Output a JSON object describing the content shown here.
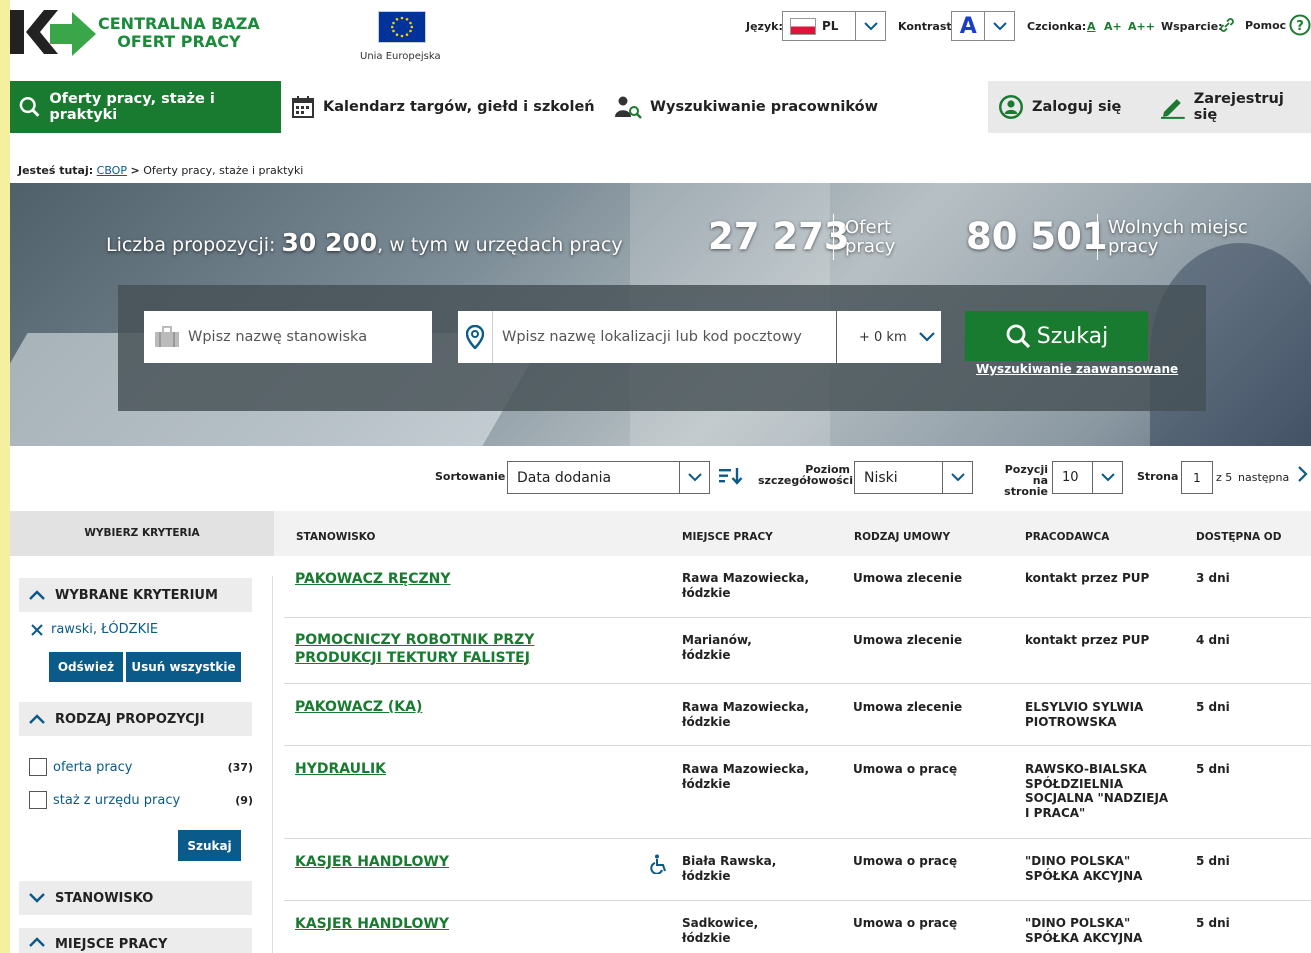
{
  "header": {
    "logo_line1": "CENTRALNA BAZA",
    "logo_line2": "OFERT PRACY",
    "eu_label": "Unia Europejska",
    "lang_label": "Język:",
    "lang_value": "PL",
    "contrast_label": "Kontrast:",
    "contrast_value": "A",
    "font_label": "Czcionka:",
    "font_a": "A",
    "font_a_plus": "A+",
    "font_a_plusplus": "A++",
    "support_label": "Wsparcie:",
    "help_label": "Pomoc"
  },
  "nav": {
    "offers": "Oferty pracy, staże i praktyki",
    "calendar": "Kalendarz targów, giełd i szkoleń",
    "employees": "Wyszukiwanie pracowników",
    "login": "Zaloguj się",
    "register": "Zarejestruj się"
  },
  "breadcrumb": {
    "prefix": "Jesteś tutaj:",
    "root": "CBOP",
    "sep": ">",
    "current": "Oferty pracy, staże i praktyki"
  },
  "hero": {
    "count_prefix": "Liczba propozycji:",
    "count_value": "30 200",
    "count_suffix": ", w tym w urzędach pracy",
    "offers_value": "27 273",
    "offers_label1": "Ofert",
    "offers_label2": "pracy",
    "vacancies_value": "80 501",
    "vacancies_label1": "Wolnych miejsc",
    "vacancies_label2": "pracy"
  },
  "search": {
    "position_placeholder": "Wpisz nazwę stanowiska",
    "location_placeholder": "Wpisz nazwę lokalizacji lub kod pocztowy",
    "distance": "+ 0 km",
    "button": "Szukaj",
    "advanced": "Wyszukiwanie zaawansowane"
  },
  "sortbar": {
    "sort_label": "Sortowanie",
    "sort_value": "Data dodania",
    "detail_label1": "Poziom",
    "detail_label2": "szczegółowości",
    "detail_value": "Niski",
    "perpage_label1": "Pozycji",
    "perpage_label2": "na stronie",
    "perpage_value": "10",
    "page_label": "Strona",
    "page_value": "1",
    "page_of": "z 5",
    "next": "następna"
  },
  "sidebar": {
    "header": "WYBIERZ KRYTERIA",
    "selected_title": "WYBRANE KRYTERIUM",
    "selected_item": "rawski, ŁÓDZKIE",
    "refresh": "Odśwież",
    "remove_all": "Usuń wszystkie",
    "type_title": "RODZAJ PROPOZYCJI",
    "type_options": [
      {
        "label": "oferta pracy",
        "count": "(37)"
      },
      {
        "label": "staż z urzędu pracy",
        "count": "(9)"
      }
    ],
    "search_btn": "Szukaj",
    "position_title": "STANOWISKO",
    "place_title": "MIEJSCE PRACY"
  },
  "table": {
    "headers": {
      "position": "STANOWISKO",
      "place": "MIEJSCE PRACY",
      "contract": "RODZAJ UMOWY",
      "employer": "PRACODAWCA",
      "available": "DOSTĘPNA OD"
    },
    "rows": [
      {
        "title": "PAKOWACZ RĘCZNY",
        "place": "Rawa Mazowiecka, łódzkie",
        "contract": "Umowa zlecenie",
        "employer": "kontakt przez PUP",
        "available": "3 dni"
      },
      {
        "title": "POMOCNICZY ROBOTNIK PRZY PRODUKCJI TEKTURY FALISTEJ",
        "place": "Marianów, łódzkie",
        "contract": "Umowa zlecenie",
        "employer": "kontakt przez PUP",
        "available": "4 dni"
      },
      {
        "title": "PAKOWACZ (KA)",
        "place": "Rawa Mazowiecka, łódzkie",
        "contract": "Umowa zlecenie",
        "employer": "ELSYLVIO SYLWIA PIOTROWSKA",
        "available": "5 dni"
      },
      {
        "title": "HYDRAULIK",
        "place": "Rawa Mazowiecka, łódzkie",
        "contract": "Umowa o pracę",
        "employer": "RAWSKO-BIALSKA SPÓŁDZIELNIA SOCJALNA \"NADZIEJA I PRACA\"",
        "available": "5 dni"
      },
      {
        "title": "KASJER HANDLOWY",
        "place": "Biała Rawska, łódzkie",
        "contract": "Umowa o pracę",
        "employer": "\"DINO POLSKA\" SPÓŁKA AKCYJNA",
        "available": "5 dni"
      },
      {
        "title": "KASJER HANDLOWY",
        "place": "Sadkowice, łódzkie",
        "contract": "Umowa o pracę",
        "employer": "\"DINO POLSKA\" SPÓŁKA AKCYJNA",
        "available": "5 dni"
      }
    ]
  },
  "colors": {
    "brand_green": "#197b30",
    "link_blue": "#0a5a8a"
  }
}
